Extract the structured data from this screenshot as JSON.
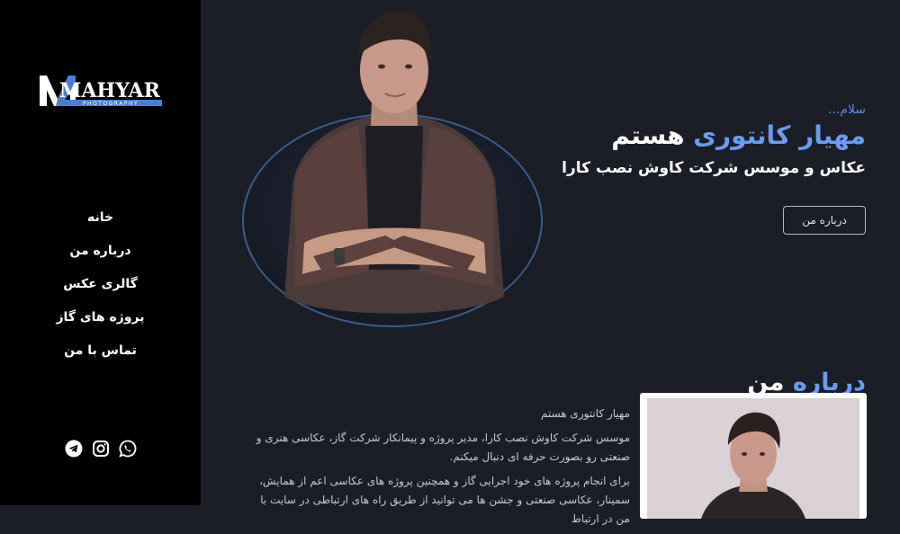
{
  "brand": {
    "logo_main": "MAHYAR",
    "logo_sub": "PHOTOGRAPHY"
  },
  "nav": [
    {
      "label": "خانه"
    },
    {
      "label": "درباره من"
    },
    {
      "label": "گالری عکس"
    },
    {
      "label": "پروژه های گاز"
    },
    {
      "label": "تماس با من"
    }
  ],
  "socials": [
    "telegram-icon",
    "instagram-icon",
    "whatsapp-icon"
  ],
  "hero": {
    "greeting": "سلام...",
    "title_accent": "مهیار کانتوری",
    "title_rest": " هستم",
    "subtitle": "عکاس و موسس شرکت کاوش نصب کارا",
    "button_label": "درباره من"
  },
  "about": {
    "heading_accent": "درباره",
    "heading_rest": " من",
    "p1": "مهیار کانتوری هستم",
    "p2": "موسس شرکت کاوش نصب کارا، مدیر پروژه و پیمانکار شرکت گاز، عکاسی هنری و صنعتی رو بصورت حرفه ای دنبال میکنم.",
    "p3": "برای انجام پروژه های خود اجرایی گاز و همچنین پروژه های عکاسی اعم از همایش، سمینار، عکاسی صنعتی و جشن ها می توانید از طریق راه های ارتباطی در سایت با من در ارتباط"
  },
  "colors": {
    "accent": "#6a9cf0",
    "sidebar_bg": "#000000",
    "main_bg": "#1b1d27"
  }
}
